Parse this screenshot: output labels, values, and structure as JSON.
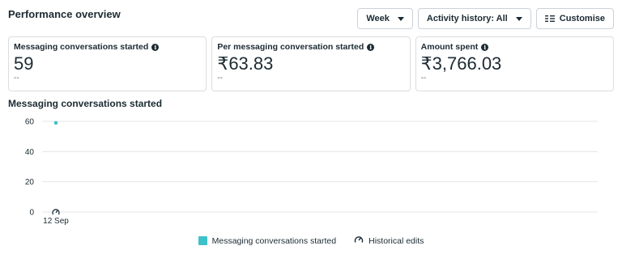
{
  "header": {
    "title": "Performance overview"
  },
  "toolbar": {
    "period_label": "Week",
    "activity_label": "Activity history: All",
    "customise_label": "Customise"
  },
  "cards": [
    {
      "label": "Messaging conversations started",
      "value": "59",
      "sub": "--"
    },
    {
      "label": "Per messaging conversation started",
      "value": "₹63.83",
      "sub": "--"
    },
    {
      "label": "Amount spent",
      "value": "₹3,766.03",
      "sub": "--"
    }
  ],
  "chart": {
    "title": "Messaging conversations started"
  },
  "legend": {
    "series_label": "Messaging conversations started",
    "edits_label": "Historical edits"
  },
  "colors": {
    "series": "#3fc1c9",
    "grid": "#e4e6eb",
    "text": "#1c2b33"
  },
  "chart_data": {
    "type": "scatter",
    "title": "Messaging conversations started",
    "x": [
      "12 Sep"
    ],
    "series": [
      {
        "name": "Messaging conversations started",
        "values": [
          59
        ]
      }
    ],
    "y_ticks": [
      0,
      20,
      40,
      60
    ],
    "ylim": [
      0,
      60
    ],
    "grid": true,
    "legend_position": "bottom",
    "annotations": [
      {
        "type": "historical-edit",
        "x": "12 Sep"
      }
    ]
  }
}
